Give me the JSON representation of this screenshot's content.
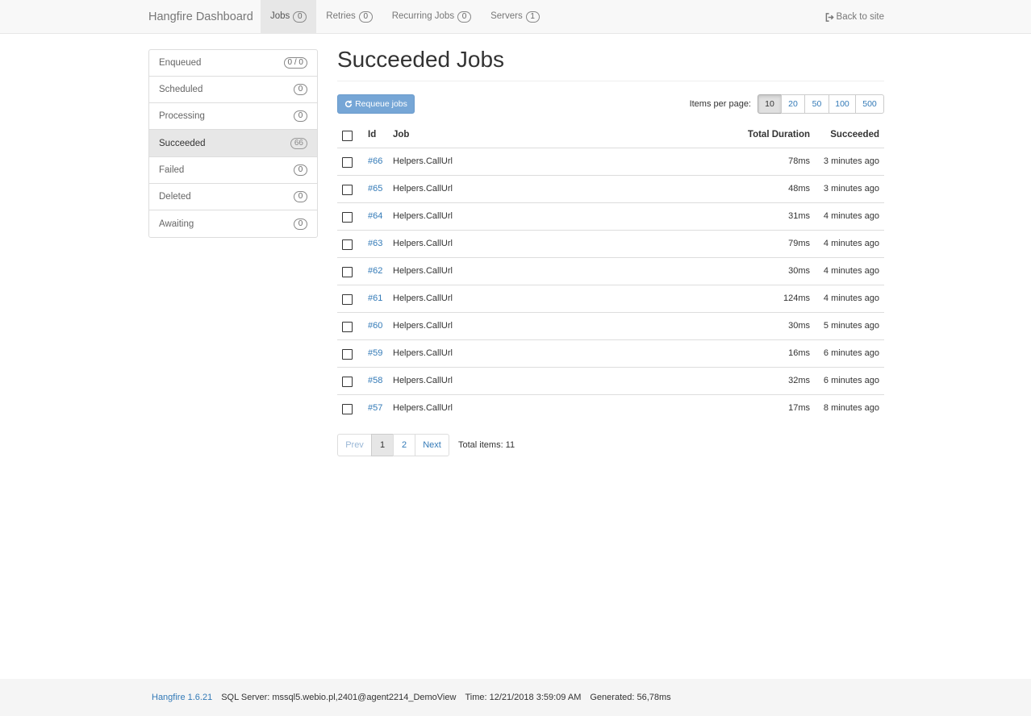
{
  "navbar": {
    "brand": "Hangfire Dashboard",
    "items": [
      {
        "label": "Jobs",
        "count": "0"
      },
      {
        "label": "Retries",
        "count": "0"
      },
      {
        "label": "Recurring Jobs",
        "count": "0"
      },
      {
        "label": "Servers",
        "count": "1"
      }
    ],
    "back_label": "Back to site"
  },
  "sidebar": {
    "items": [
      {
        "label": "Enqueued",
        "count": "0 / 0"
      },
      {
        "label": "Scheduled",
        "count": "0"
      },
      {
        "label": "Processing",
        "count": "0"
      },
      {
        "label": "Succeeded",
        "count": "66"
      },
      {
        "label": "Failed",
        "count": "0"
      },
      {
        "label": "Deleted",
        "count": "0"
      },
      {
        "label": "Awaiting",
        "count": "0"
      }
    ]
  },
  "main": {
    "title": "Succeeded Jobs",
    "requeue_label": "Requeue jobs",
    "items_per_page_label": "Items per page:",
    "page_sizes": [
      "10",
      "20",
      "50",
      "100",
      "500"
    ],
    "selected_page_size": "10"
  },
  "table": {
    "headers": {
      "id": "Id",
      "job": "Job",
      "duration": "Total Duration",
      "succeeded": "Succeeded"
    },
    "rows": [
      {
        "id": "#66",
        "job": "Helpers.CallUrl",
        "duration": "78ms",
        "succeeded": "3 minutes ago"
      },
      {
        "id": "#65",
        "job": "Helpers.CallUrl",
        "duration": "48ms",
        "succeeded": "3 minutes ago"
      },
      {
        "id": "#64",
        "job": "Helpers.CallUrl",
        "duration": "31ms",
        "succeeded": "4 minutes ago"
      },
      {
        "id": "#63",
        "job": "Helpers.CallUrl",
        "duration": "79ms",
        "succeeded": "4 minutes ago"
      },
      {
        "id": "#62",
        "job": "Helpers.CallUrl",
        "duration": "30ms",
        "succeeded": "4 minutes ago"
      },
      {
        "id": "#61",
        "job": "Helpers.CallUrl",
        "duration": "124ms",
        "succeeded": "4 minutes ago"
      },
      {
        "id": "#60",
        "job": "Helpers.CallUrl",
        "duration": "30ms",
        "succeeded": "5 minutes ago"
      },
      {
        "id": "#59",
        "job": "Helpers.CallUrl",
        "duration": "16ms",
        "succeeded": "6 minutes ago"
      },
      {
        "id": "#58",
        "job": "Helpers.CallUrl",
        "duration": "32ms",
        "succeeded": "6 minutes ago"
      },
      {
        "id": "#57",
        "job": "Helpers.CallUrl",
        "duration": "17ms",
        "succeeded": "8 minutes ago"
      }
    ]
  },
  "pager": {
    "prev": "Prev",
    "pages": [
      "1",
      "2"
    ],
    "current": "1",
    "next": "Next",
    "total": "Total items: 11"
  },
  "footer": {
    "version": "Hangfire 1.6.21",
    "storage": "SQL Server: mssql5.webio.pl,2401@agent2214_DemoView",
    "time": "Time: 12/21/2018 3:59:09 AM",
    "generated": "Generated: 56,78ms"
  }
}
